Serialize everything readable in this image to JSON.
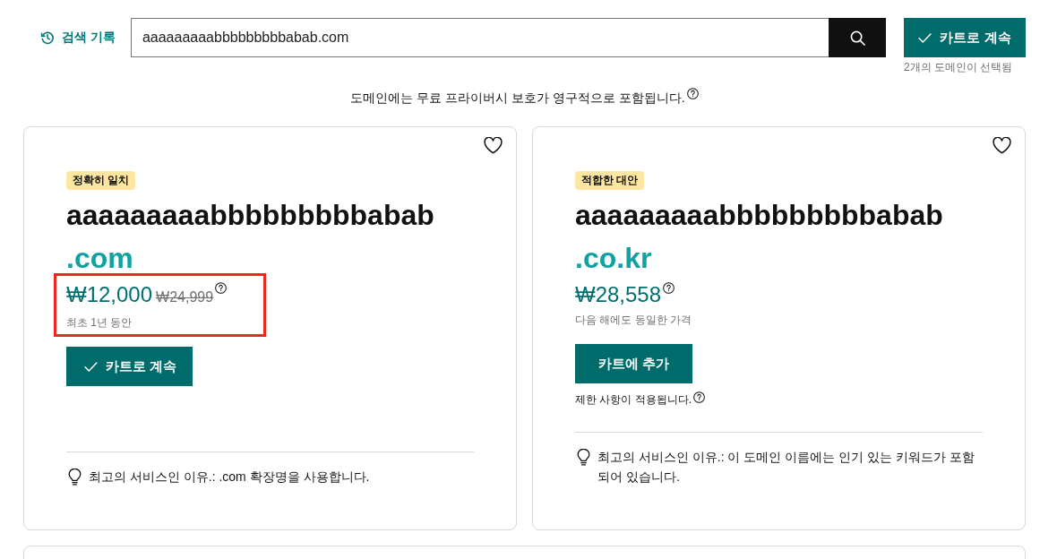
{
  "search_bar": {
    "history_link": "검색 기록",
    "query": "aaaaaaaaabbbbbbbbbabab.com"
  },
  "cart": {
    "button": "카트로 계속",
    "selection_note": "2개의 도메인이 선택됨"
  },
  "privacy_note": "도메인에는 무료 프라이버시 보호가 영구적으로 포함됩니다.",
  "results": [
    {
      "badge": "정확히 일치",
      "favorited": false,
      "name": "aaaaaaaaabbbbbbbbbabab",
      "tld": ".com",
      "price": "₩12,000",
      "original_price": "₩24,999",
      "price_note": "최초 1년 동안",
      "highlighted": true,
      "in_cart": true,
      "button": "카트로 계속",
      "reason": "최고의 서비스인 이유.: .com 확장명을 사용합니다."
    },
    {
      "badge": "적합한 대안",
      "favorited": false,
      "name": "aaaaaaaaabbbbbbbbbabab",
      "tld": ".co.kr",
      "price": "₩28,558",
      "price_note": "다음 해에도 동일한 가격",
      "highlighted": false,
      "in_cart": false,
      "button": "카트에 추가",
      "restriction_note": "제한 사항이 적용됩니다.",
      "reason": "최고의 서비스인 이유.: 이 도메인 이름에는 인기 있는 키워드가 포함되어 있습니다."
    }
  ],
  "more_results": true
}
